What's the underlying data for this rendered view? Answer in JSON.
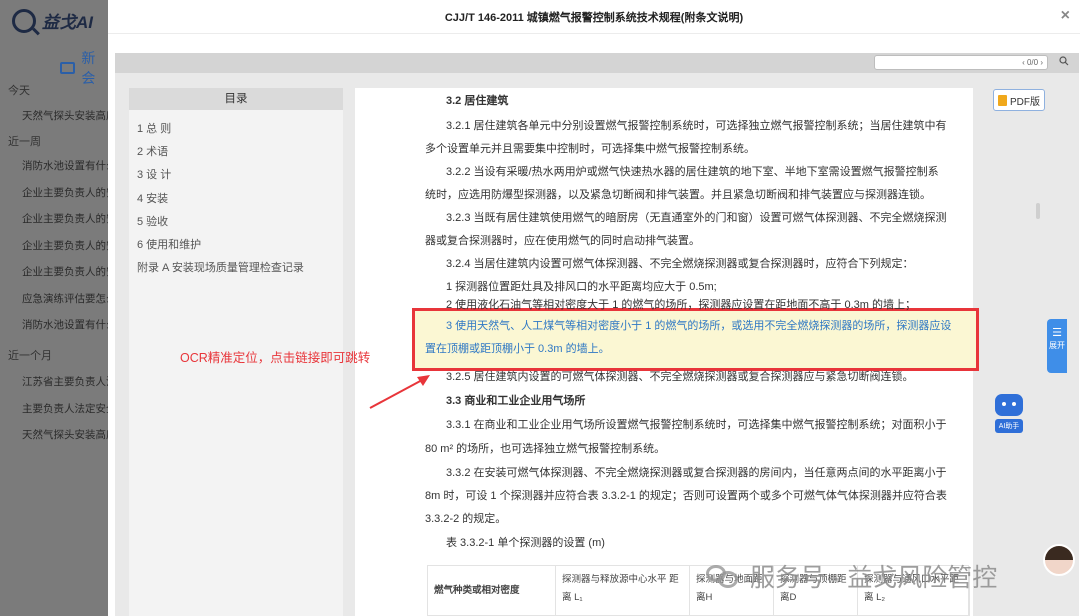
{
  "bg_app": {
    "logo_text": "益戈AI",
    "new_chat_label": "新会",
    "sections": [
      {
        "label": "今天",
        "items": [
          "天然气探头安装高度"
        ]
      },
      {
        "label": "近一周",
        "items": [
          "消防水池设置有什么",
          "企业主要负责人的安",
          "企业主要负责人的安",
          "企业主要负责人的安",
          "企业主要负责人的安",
          "应急演练评估要怎么",
          "消防水池设置有什么"
        ]
      },
      {
        "label": "近一个月",
        "items": [
          "江苏省主要负责人法",
          "主要负责人法定安全",
          "天然气探头安装高度"
        ]
      }
    ]
  },
  "modal": {
    "title": "CJJ/T 146-2011 城镇燃气报警控制系统技术规程(附条文说明)",
    "close_glyph": "×",
    "search": {
      "placeholder": "",
      "pager": "‹ 0/0 ›"
    },
    "pdf_label": "PDF版"
  },
  "toc": {
    "title": "目录",
    "items": [
      "1 总 则",
      "2 术语",
      "3 设 计",
      "4 安装",
      "5 验收",
      "6 使用和维护",
      "附录 A 安装现场质量管理检查记录"
    ]
  },
  "page": {
    "lines": [
      {
        "text": "3.2 居住建筑",
        "style": "h"
      },
      {
        "text": "3.2.1 居住建筑各单元中分别设置燃气报警控制系统时，可选择独立燃气报警控制系统；当居住建筑中有",
        "style": "p"
      },
      {
        "text": "多个设置单元并且需要集中控制时，可选择集中燃气报警控制系统。",
        "style": "p"
      },
      {
        "text": "3.2.2 当设有采暖/热水两用炉或燃气快速热水器的居住建筑的地下室、半地下室需设置燃气报警控制系",
        "style": "p"
      },
      {
        "text": "统时，应选用防爆型探测器，以及紧急切断阀和排气装置。并且紧急切断阀和排气装置应与探测器连锁。",
        "style": "p"
      },
      {
        "text": "3.2.3 当既有居住建筑使用燃气的暗厨房（无直通室外的门和窗）设置可燃气体探测器、不完全燃烧探测",
        "style": "p"
      },
      {
        "text": "器或复合探测器时，应在使用燃气的同时启动排气装置。",
        "style": "p"
      },
      {
        "text": "3.2.4 当居住建筑内设置可燃气体探测器、不完全燃烧探测器或复合探测器时，应符合下列规定：",
        "style": "p"
      },
      {
        "text": "1 探测器位置距灶具及排风口的水平距离均应大于 0.5m;",
        "style": "p"
      },
      {
        "text": "2 使用液化石油气等相对密度大于 1 的燃气的场所，探测器应设置在距地面不高于 0.3m 的墙上；",
        "style": "p"
      },
      {
        "text": "3 使用天然气、人工煤气等相对密度小于 1 的燃气的场所，或选用不完全燃烧探测器的场所，探测器应设",
        "style": "hl"
      },
      {
        "text": "置在顶棚或距顶棚小于 0.3m 的墙上。",
        "style": "hl"
      },
      {
        "text": "3.2.5 居住建筑内设置的可燃气体探测器、不完全燃烧探测器或复合探测器应与紧急切断阀连锁。",
        "style": "p"
      },
      {
        "text": "3.3 商业和工业企业用气场所",
        "style": "h"
      },
      {
        "text": "3.3.1 在商业和工业企业用气场所设置燃气报警控制系统时，可选择集中燃气报警控制系统；对面积小于",
        "style": "p"
      },
      {
        "text": "80 m² 的场所，也可选择独立燃气报警控制系统。",
        "style": "p"
      },
      {
        "text": "3.3.2 在安装可燃气体探测器、不完全燃烧探测器或复合探测器的房间内，当任意两点间的水平距离小于",
        "style": "p"
      },
      {
        "text": "8m 时，可设 1 个探测器并应符合表 3.3.2-1 的规定；否则可设置两个或多个可燃气体气体探测器并应符合表",
        "style": "p"
      },
      {
        "text": "3.3.2-2 的规定。",
        "style": "p"
      },
      {
        "text": "表 3.3.2-1 单个探测器的设置 (m)",
        "style": "p"
      }
    ],
    "table_headers": [
      "燃气种类或相对密度",
      "探测器与释放源中心水平 距离 L₁",
      "探测器与地面距离H",
      "探测器与顶棚距离D",
      "探测器与通风口水平距离 L₂"
    ]
  },
  "annotation": "OCR精准定位，点击链接即可跳转",
  "right_widgets": {
    "expand_label": "展开",
    "ai_label": "AI助手"
  },
  "watermark": "服务号 · 益戈风险管控",
  "colors": {
    "highlight_border": "#e8353a",
    "highlight_text": "#2f78c4",
    "accent": "#3f8ee8"
  }
}
